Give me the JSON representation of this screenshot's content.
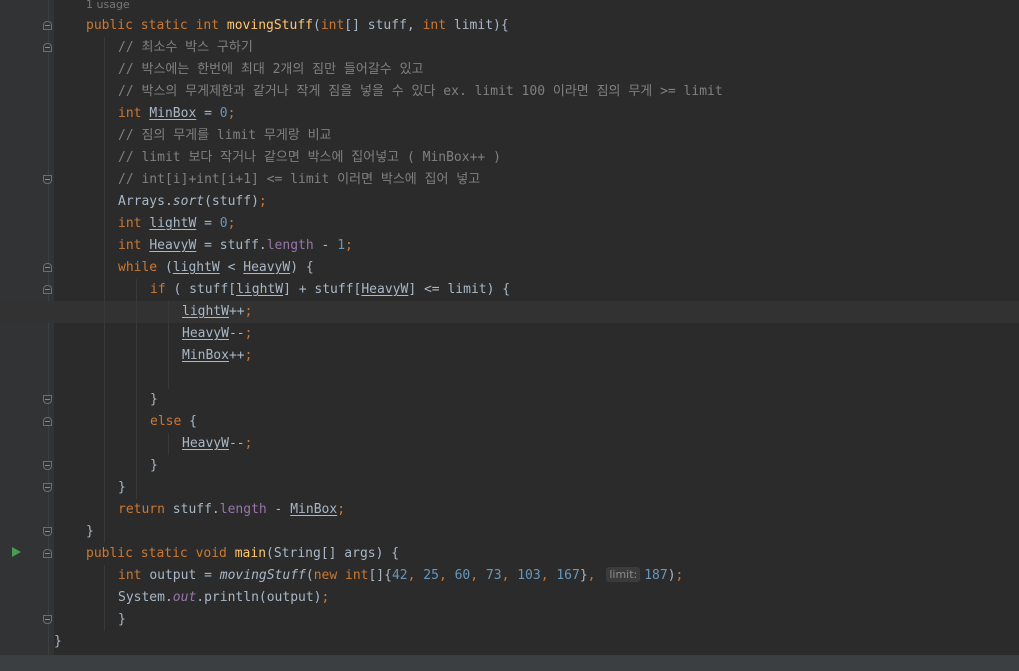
{
  "editor": {
    "usage_hint": "1 usage",
    "lines": [
      {
        "t": [
          [
            "kw",
            "public static int "
          ],
          [
            "fn",
            "movingStuff"
          ],
          [
            "",
            "("
          ],
          [
            "kw",
            "int"
          ],
          [
            "",
            "[] stuff, "
          ],
          [
            "kw",
            "int"
          ],
          [
            "",
            " limit){"
          ]
        ]
      },
      {
        "t": [
          [
            "cm",
            "// 최소수 박스 구하기"
          ]
        ]
      },
      {
        "t": [
          [
            "cm",
            "// 박스에는 한번에 최대 2개의 짐만 들어갈수 있고"
          ]
        ]
      },
      {
        "t": [
          [
            "cm",
            "// 박스의 무게제한과 같거나 작게 짐을 넣을 수 있다 ex. limit 100 이라면 짐의 무게 >= limit"
          ]
        ]
      },
      {
        "t": [
          [
            "kw",
            "int "
          ],
          [
            "u",
            "MinBox"
          ],
          [
            "",
            " = "
          ],
          [
            "num",
            "0"
          ],
          [
            "kw",
            ";"
          ]
        ]
      },
      {
        "t": [
          [
            "cm",
            "// 짐의 무게를 limit 무게랑 비교"
          ]
        ]
      },
      {
        "t": [
          [
            "cm",
            "// limit 보다 작거나 같으면 박스에 집어넣고 ( MinBox++ )"
          ]
        ]
      },
      {
        "t": [
          [
            "cm",
            "// int[i]+int[i+1] <= limit 이러면 박스에 집어 넣고"
          ]
        ]
      },
      {
        "t": [
          [
            "",
            "Arrays."
          ],
          [
            "it",
            "sort"
          ],
          [
            "",
            "(stuff)"
          ],
          [
            "kw",
            ";"
          ]
        ]
      },
      {
        "t": [
          [
            "kw",
            "int "
          ],
          [
            "u",
            "lightW"
          ],
          [
            "",
            " = "
          ],
          [
            "num",
            "0"
          ],
          [
            "kw",
            ";"
          ]
        ]
      },
      {
        "t": [
          [
            "kw",
            "int "
          ],
          [
            "u",
            "HeavyW"
          ],
          [
            "",
            " = stuff."
          ],
          [
            "fld",
            "length"
          ],
          [
            "",
            " - "
          ],
          [
            "num",
            "1"
          ],
          [
            "kw",
            ";"
          ]
        ]
      },
      {
        "t": [
          [
            "kw",
            "while "
          ],
          [
            "",
            "("
          ],
          [
            "u",
            "lightW"
          ],
          [
            "",
            " < "
          ],
          [
            "u",
            "HeavyW"
          ],
          [
            "",
            ") {"
          ]
        ]
      },
      {
        "t": [
          [
            "kw",
            "if "
          ],
          [
            "",
            "( stuff["
          ],
          [
            "u",
            "lightW"
          ],
          [
            "",
            "] + stuff["
          ],
          [
            "u",
            "HeavyW"
          ],
          [
            "",
            "] <= limit) {"
          ]
        ]
      },
      {
        "t": [
          [
            "u",
            "lightW"
          ],
          [
            "",
            "++"
          ],
          [
            "kw",
            ";"
          ]
        ]
      },
      {
        "t": [
          [
            "u",
            "HeavyW"
          ],
          [
            "",
            "--"
          ],
          [
            "kw",
            ";"
          ]
        ]
      },
      {
        "t": [
          [
            "u",
            "MinBox"
          ],
          [
            "",
            "++"
          ],
          [
            "kw",
            ";"
          ]
        ]
      },
      {
        "t": []
      },
      {
        "t": [
          [
            "",
            "}"
          ]
        ]
      },
      {
        "t": [
          [
            "kw",
            "else "
          ],
          [
            "",
            "{"
          ]
        ]
      },
      {
        "t": [
          [
            "u",
            "HeavyW"
          ],
          [
            "",
            "--"
          ],
          [
            "kw",
            ";"
          ]
        ]
      },
      {
        "t": [
          [
            "",
            "}"
          ]
        ]
      },
      {
        "t": [
          [
            "",
            "}"
          ]
        ]
      },
      {
        "t": [
          [
            "kw",
            "return "
          ],
          [
            "",
            "stuff."
          ],
          [
            "fld",
            "length"
          ],
          [
            "",
            " - "
          ],
          [
            "u",
            "MinBox"
          ],
          [
            "kw",
            ";"
          ]
        ]
      },
      {
        "t": [
          [
            "",
            "}"
          ]
        ]
      },
      {
        "t": [
          [
            "kw",
            "public static void "
          ],
          [
            "fn",
            "main"
          ],
          [
            "",
            "(String[] args) {"
          ]
        ]
      },
      {
        "t": [
          [
            "kw",
            "int "
          ],
          [
            "",
            "output = "
          ],
          [
            "it",
            "movingStuff"
          ],
          [
            "",
            "("
          ],
          [
            "kw",
            "new int"
          ],
          [
            "",
            "[]{"
          ],
          [
            "num",
            "42"
          ],
          [
            "kw",
            ", "
          ],
          [
            "num",
            "25"
          ],
          [
            "kw",
            ", "
          ],
          [
            "num",
            "60"
          ],
          [
            "kw",
            ", "
          ],
          [
            "num",
            "73"
          ],
          [
            "kw",
            ", "
          ],
          [
            "num",
            "103"
          ],
          [
            "kw",
            ", "
          ],
          [
            "num",
            "167"
          ],
          [
            "",
            "}"
          ],
          [
            "kw",
            ", "
          ],
          [
            "hint",
            "limit:"
          ],
          [
            "num",
            "187"
          ],
          [
            "",
            ")"
          ],
          [
            "kw",
            ";"
          ]
        ]
      },
      {
        "t": [
          [
            "",
            "System."
          ],
          [
            "stf",
            "out"
          ],
          [
            "",
            ".println(output)"
          ],
          [
            "kw",
            ";"
          ]
        ]
      },
      {
        "t": [
          [
            "",
            "}"
          ]
        ]
      },
      {
        "t": [
          [
            "",
            "}"
          ]
        ]
      }
    ]
  }
}
